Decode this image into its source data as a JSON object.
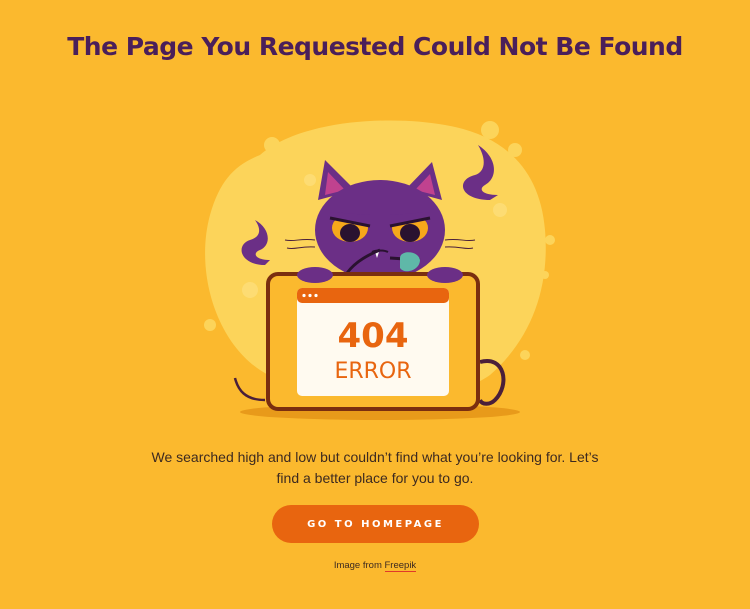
{
  "page": {
    "title": "The Page You Requested Could Not Be Found",
    "message": "We searched high and low but couldn’t find what you’re looking for. Let’s find a better place for you to go.",
    "cta_label": "GO TO HOMEPAGE",
    "credit_prefix": "Image from",
    "credit_link": "Freepik"
  },
  "illustration": {
    "code": "404",
    "label": "ERROR",
    "icon": "cat-with-laptop-illustration"
  },
  "colors": {
    "background": "#fbb92e",
    "title": "#4a1f5a",
    "button": "#e8650f",
    "cat": "#6b2f86",
    "screen_text": "#e8650f"
  }
}
